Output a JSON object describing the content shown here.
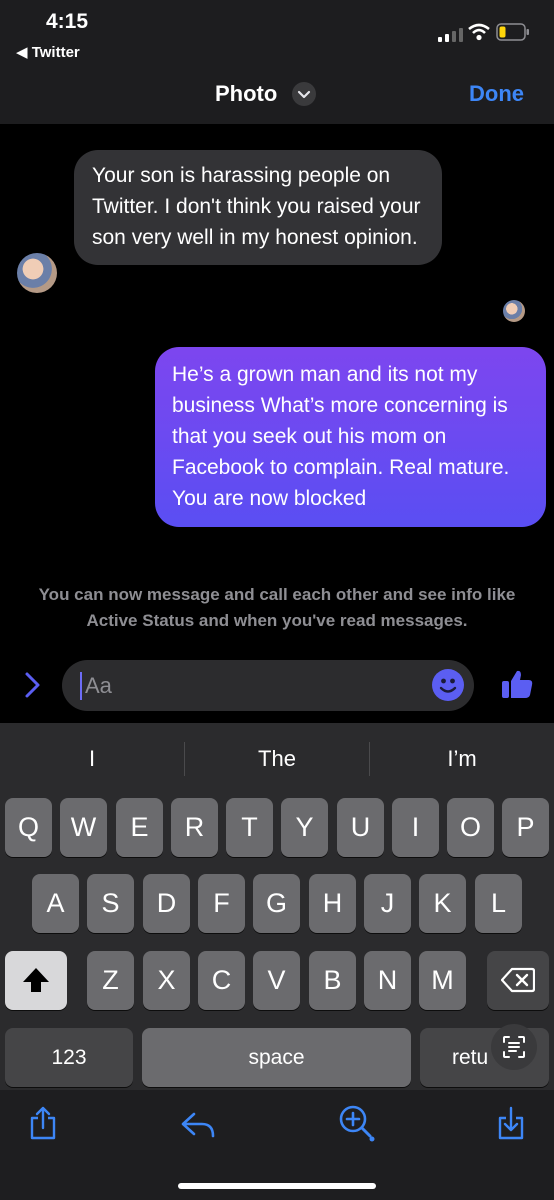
{
  "status_bar": {
    "time": "4:15",
    "back_app": "◀ Twitter"
  },
  "nav": {
    "title": "Photo",
    "done_label": "Done"
  },
  "messages": [
    {
      "direction": "incoming",
      "text": "Your son is harassing people on Twitter. I don't think you raised your son very well in my honest opinion."
    },
    {
      "direction": "outgoing",
      "text": "He’s a grown man and its not my business What’s more concerning is that you seek out his mom on Facebook to complain. Real mature. You are now blocked"
    }
  ],
  "info_text": "You can now message and call each other and see info like Active Status and when you've read messages.",
  "composer": {
    "placeholder": "Aa"
  },
  "suggestions": [
    "I",
    "The",
    "I’m"
  ],
  "keyboard": {
    "row1": [
      "Q",
      "W",
      "E",
      "R",
      "T",
      "Y",
      "U",
      "I",
      "O",
      "P"
    ],
    "row2": [
      "A",
      "S",
      "D",
      "F",
      "G",
      "H",
      "J",
      "K",
      "L"
    ],
    "row3": [
      "Z",
      "X",
      "C",
      "V",
      "B",
      "N",
      "M"
    ],
    "numbers_label": "123",
    "space_label": "space",
    "return_label": "retu"
  },
  "colors": {
    "accent": "#3d86f6",
    "outgoing_bubble": "#6a4cf1",
    "incoming_bubble": "#333336",
    "messenger_blue": "#5b5ef2"
  },
  "icons": [
    "chevron-right-icon",
    "emoji-icon",
    "thumbs-up-icon",
    "shift-icon",
    "backspace-icon",
    "live-text-icon",
    "share-icon",
    "reply-icon",
    "zoom-icon",
    "download-icon"
  ]
}
